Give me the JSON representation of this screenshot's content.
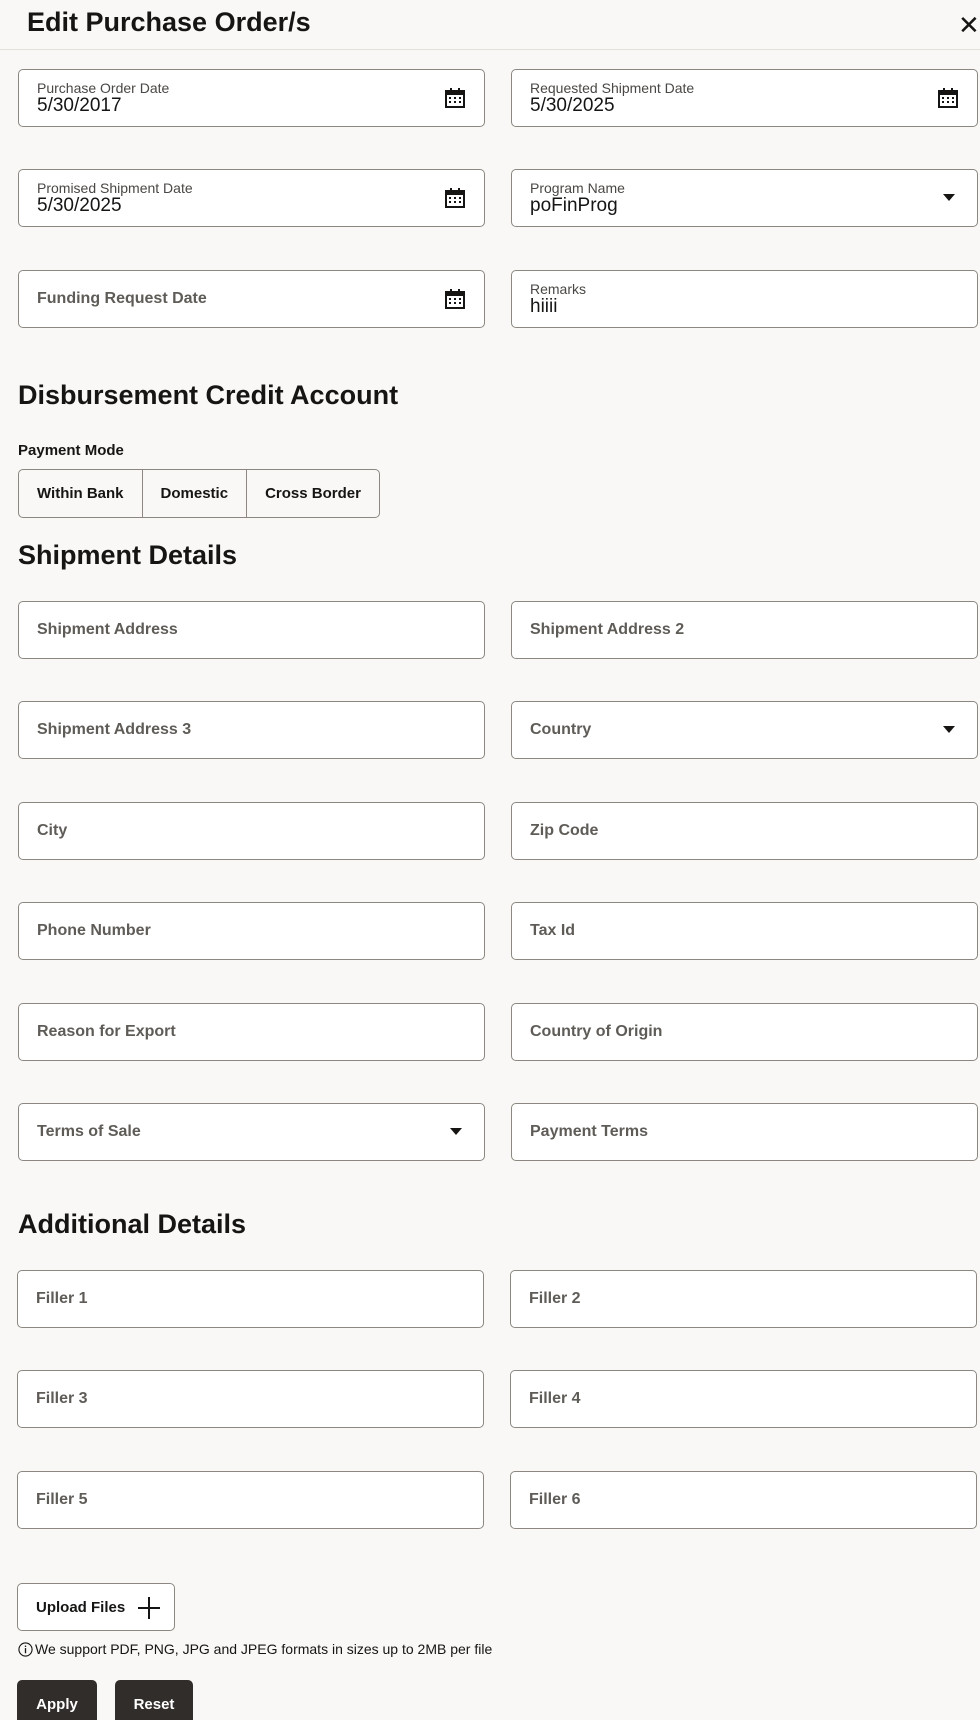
{
  "header": {
    "title": "Edit Purchase Order/s",
    "close_symbol": "✕"
  },
  "form": {
    "po_date": {
      "label": "Purchase Order Date",
      "value": "5/30/2017"
    },
    "req_ship_date": {
      "label": "Requested Shipment Date",
      "value": "5/30/2025"
    },
    "promised_ship_date": {
      "label": "Promised Shipment Date",
      "value": "5/30/2025"
    },
    "program_name": {
      "label": "Program Name",
      "value": "poFinProg"
    },
    "funding_request_date": {
      "placeholder": "Funding Request Date"
    },
    "remarks": {
      "label": "Remarks",
      "value": "hiiii"
    }
  },
  "disbursement": {
    "title": "Disbursement Credit Account",
    "payment_mode_label": "Payment Mode",
    "modes": [
      "Within Bank",
      "Domestic",
      "Cross Border"
    ]
  },
  "shipment": {
    "title": "Shipment Details",
    "fields": {
      "address": "Shipment Address",
      "address2": "Shipment Address 2",
      "address3": "Shipment Address 3",
      "country": "Country",
      "city": "City",
      "zip": "Zip Code",
      "phone": "Phone Number",
      "tax_id": "Tax Id",
      "reason_export": "Reason for Export",
      "country_origin": "Country of Origin",
      "terms_sale": "Terms of Sale",
      "payment_terms": "Payment Terms"
    }
  },
  "additional": {
    "title": "Additional Details",
    "fillers": [
      "Filler 1",
      "Filler 2",
      "Filler 3",
      "Filler 4",
      "Filler 5",
      "Filler 6"
    ]
  },
  "upload": {
    "label": "Upload Files",
    "hint": "We support PDF, PNG, JPG and JPEG formats in sizes up to 2MB per file"
  },
  "actions": {
    "apply": "Apply",
    "reset": "Reset"
  },
  "icons": {
    "calendar": "calendar-icon",
    "dropdown": "chevron-down-icon",
    "close": "close-icon",
    "plus": "plus-icon",
    "info": "info-icon"
  },
  "colors": {
    "background": "#f9f8f6",
    "border": "#8c8781",
    "primary_button": "#312d2a",
    "text": "#161513"
  }
}
